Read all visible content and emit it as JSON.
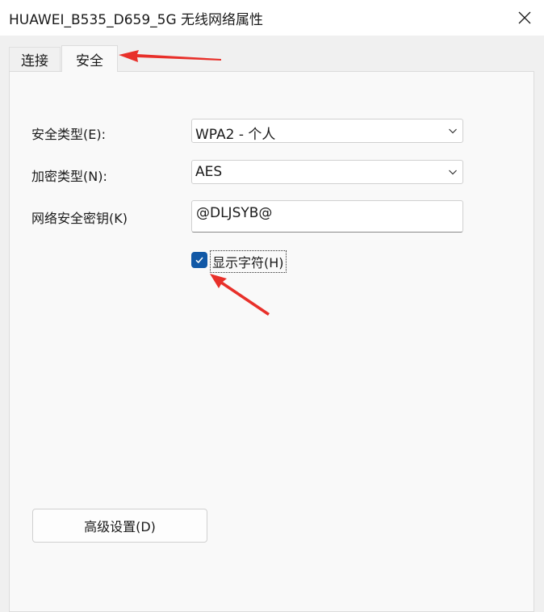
{
  "window": {
    "title": "HUAWEI_B535_D659_5G 无线网络属性",
    "close_icon": "close-icon"
  },
  "tabs": [
    {
      "label": "连接",
      "selected": false
    },
    {
      "label": "安全",
      "selected": true
    }
  ],
  "form": {
    "security_type": {
      "label": "安全类型(E):",
      "value": "WPA2 - 个人"
    },
    "encryption_type": {
      "label": "加密类型(N):",
      "value": "AES"
    },
    "network_key": {
      "label": "网络安全密钥(K)",
      "value": "@DLJSYB@"
    },
    "show_characters": {
      "label": "显示字符(H)",
      "checked": true
    }
  },
  "buttons": {
    "advanced_settings": "高级设置(D)"
  },
  "colors": {
    "accent": "#1158a6",
    "annotation_arrow": "#e8302a"
  }
}
